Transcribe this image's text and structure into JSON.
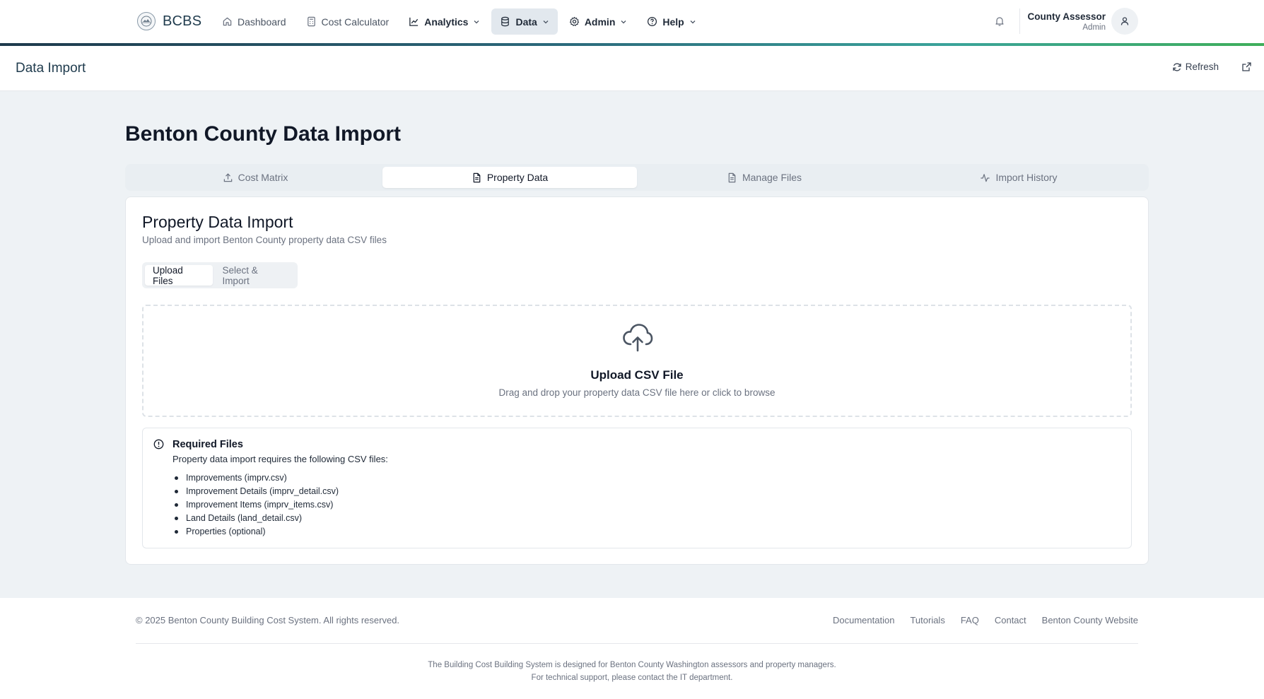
{
  "nav": {
    "brand": "BCBS",
    "items": [
      {
        "label": "Dashboard"
      },
      {
        "label": "Cost Calculator"
      },
      {
        "label": "Analytics"
      },
      {
        "label": "Data"
      },
      {
        "label": "Admin"
      },
      {
        "label": "Help"
      }
    ],
    "user": {
      "name": "County Assessor",
      "role": "Admin"
    }
  },
  "header": {
    "title": "Data Import",
    "refresh_label": "Refresh"
  },
  "main": {
    "title": "Benton County Data Import",
    "tabs": [
      {
        "label": "Cost Matrix"
      },
      {
        "label": "Property Data"
      },
      {
        "label": "Manage Files"
      },
      {
        "label": "Import History"
      }
    ],
    "active_tab": "Property Data"
  },
  "card": {
    "title": "Property Data Import",
    "subtitle": "Upload and import Benton County property data CSV files",
    "subtabs": [
      {
        "label": "Upload Files"
      },
      {
        "label": "Select & Import"
      }
    ],
    "active_subtab": "Upload Files",
    "dropzone": {
      "title": "Upload CSV File",
      "subtitle": "Drag and drop your property data CSV file here or click to browse"
    },
    "required": {
      "title": "Required Files",
      "description": "Property data import requires the following CSV files:",
      "files": [
        "Improvements (imprv.csv)",
        "Improvement Details (imprv_detail.csv)",
        "Improvement Items (imprv_items.csv)",
        "Land Details (land_detail.csv)",
        "Properties (optional)"
      ]
    }
  },
  "footer": {
    "copyright": "© 2025 Benton County Building Cost System. All rights reserved.",
    "links": [
      "Documentation",
      "Tutorials",
      "FAQ",
      "Contact",
      "Benton County Website"
    ],
    "note1": "The Building Cost Building System is designed for Benton County Washington assessors and property managers.",
    "note2": "For technical support, please contact the IT department."
  },
  "colors": {
    "accent_gradient": [
      "#1e3a4c",
      "#3aa39a",
      "#3fae5a"
    ],
    "background": "#eef2f5",
    "active_nav": "#e2e8ee"
  }
}
